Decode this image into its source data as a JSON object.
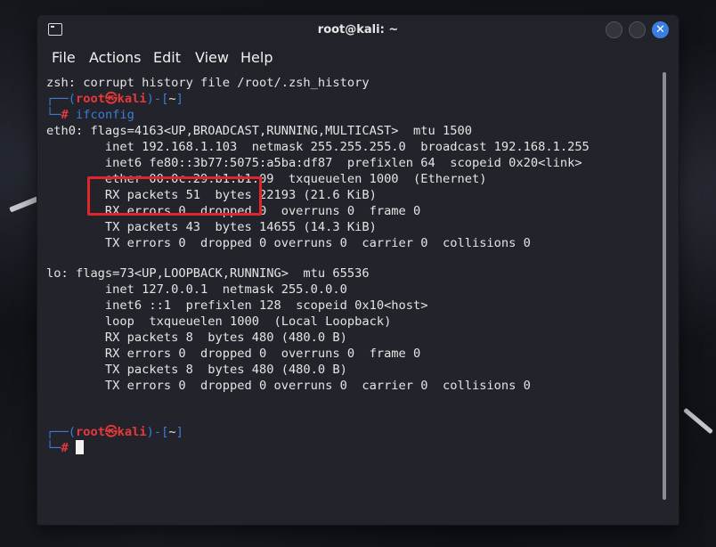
{
  "window": {
    "title": "root@kali: ~",
    "close_glyph": "✕"
  },
  "menu": [
    "File",
    "Actions",
    "Edit",
    "View",
    "Help"
  ],
  "prompt": {
    "top_left": "┌──(",
    "user": "root",
    "at": "㉿",
    "host": "kali",
    "mid": ")-[",
    "dir": "~",
    "end": "]",
    "bottom_left": "└─",
    "hash": "#"
  },
  "terminal": {
    "line1": "zsh: corrupt history file /root/.zsh_history",
    "command1": "ifconfig",
    "eth0": [
      "eth0: flags=4163<UP,BROADCAST,RUNNING,MULTICAST>  mtu 1500",
      "        inet 192.168.1.103  netmask 255.255.255.0  broadcast 192.168.1.255",
      "        inet6 fe80::3b77:5075:a5ba:df87  prefixlen 64  scopeid 0x20<link>",
      "        ether 00:0c:29:b1:b1:09  txqueuelen 1000  (Ethernet)",
      "        RX packets 51  bytes 22193 (21.6 KiB)",
      "        RX errors 0  dropped 0  overruns 0  frame 0",
      "        TX packets 43  bytes 14655 (14.3 KiB)",
      "        TX errors 0  dropped 0 overruns 0  carrier 0  collisions 0"
    ],
    "lo": [
      "lo: flags=73<UP,LOOPBACK,RUNNING>  mtu 65536",
      "        inet 127.0.0.1  netmask 255.0.0.0",
      "        inet6 ::1  prefixlen 128  scopeid 0x10<host>",
      "        loop  txqueuelen 1000  (Local Loopback)",
      "        RX packets 8  bytes 480 (480.0 B)",
      "        RX errors 0  dropped 0  overruns 0  frame 0",
      "        TX packets 8  bytes 480 (480.0 B)",
      "        TX errors 0  dropped 0 overruns 0  carrier 0  collisions 0"
    ]
  },
  "colors": {
    "prompt_blue": "#3e7ad9",
    "prompt_red": "#e8383b",
    "annotation_red": "#e0252b",
    "close_button_blue": "#3b7ee3"
  }
}
